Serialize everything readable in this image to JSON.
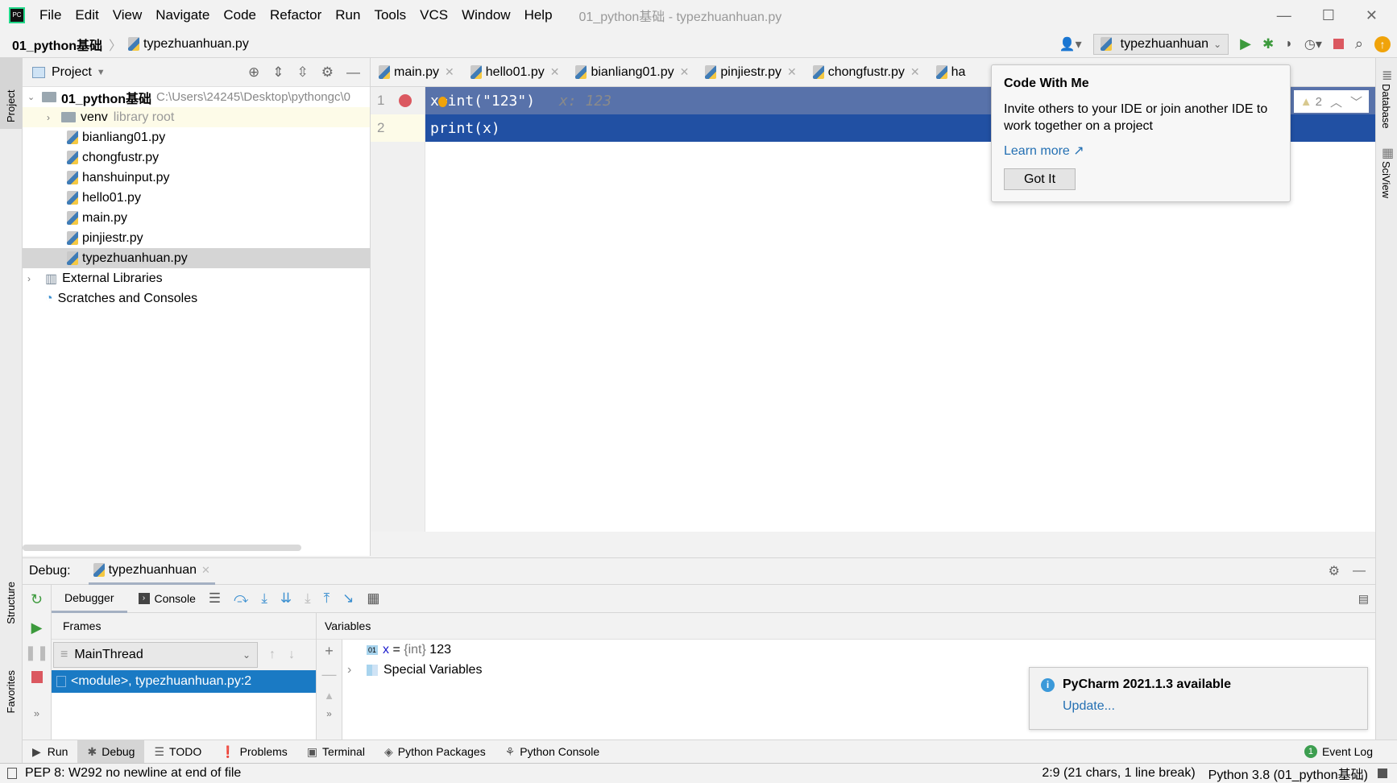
{
  "window": {
    "title": "01_python基础 - typezhuanhuan.py",
    "menu": [
      "File",
      "Edit",
      "View",
      "Navigate",
      "Code",
      "Refactor",
      "Run",
      "Tools",
      "VCS",
      "Window",
      "Help"
    ]
  },
  "breadcrumb": {
    "project": "01_python基础",
    "file": "typezhuanhuan.py"
  },
  "toolbar": {
    "run_config": "typezhuanhuan"
  },
  "project_panel": {
    "title": "Project",
    "root": "01_python基础",
    "root_path": "C:\\Users\\24245\\Desktop\\pythongc\\0",
    "venv": "venv",
    "venv_note": "library root",
    "files": [
      "bianliang01.py",
      "chongfustr.py",
      "hanshuinput.py",
      "hello01.py",
      "main.py",
      "pinjiestr.py",
      "typezhuanhuan.py"
    ],
    "selected": "typezhuanhuan.py",
    "external": "External Libraries",
    "scratches": "Scratches and Consoles"
  },
  "tabs": [
    "main.py",
    "hello01.py",
    "bianliang01.py",
    "pinjiestr.py",
    "chongfustr.py",
    "ha"
  ],
  "editor": {
    "lines": [
      {
        "num": "1",
        "code": "x=int(\"123\")",
        "hint": "x: 123"
      },
      {
        "num": "2",
        "code": "print(x)"
      }
    ],
    "warnings": "2"
  },
  "popup": {
    "title": "Code With Me",
    "body": "Invite others to your IDE or join another IDE to work together on a project",
    "link": "Learn more ↗",
    "button": "Got It"
  },
  "right_stripe": [
    "Database",
    "SciView"
  ],
  "left_stripe": [
    "Project",
    "Structure",
    "Favorites"
  ],
  "debug": {
    "label": "Debug:",
    "session": "typezhuanhuan",
    "tabs": [
      "Debugger",
      "Console"
    ],
    "frames_title": "Frames",
    "thread": "MainThread",
    "frame": "<module>, typezhuanhuan.py:2",
    "variables_title": "Variables",
    "var_name": "x",
    "var_eq": " = ",
    "var_type": "{int}",
    "var_value": " 123",
    "special": "Special Variables"
  },
  "notification": {
    "title": "PyCharm 2021.1.3 available",
    "link": "Update..."
  },
  "bottom_tools": [
    "Run",
    "Debug",
    "TODO",
    "Problems",
    "Terminal",
    "Python Packages",
    "Python Console"
  ],
  "event_log": {
    "count": "1",
    "label": "Event Log"
  },
  "status": {
    "message": "PEP 8: W292 no newline at end of file",
    "position": "2:9 (21 chars, 1 line break)",
    "interpreter": "Python 3.8 (01_python基础)"
  },
  "colors": {
    "selection": "#2150a3",
    "selection_line1": "#5872aa",
    "breakpoint": "#db5860",
    "link": "#2470b3",
    "frame_selected": "#1a7ac4"
  }
}
